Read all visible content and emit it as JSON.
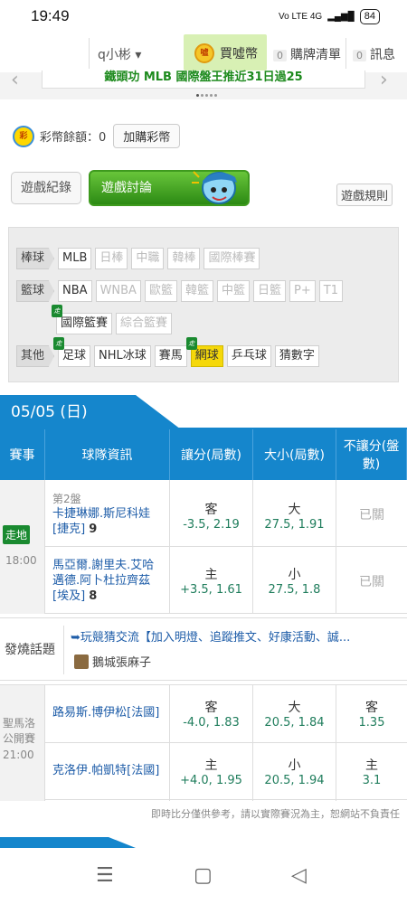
{
  "status_bar": {
    "time": "19:49",
    "network": "Vo LTE 4G",
    "battery": "84"
  },
  "topnav": {
    "user": "q小彬 ▾",
    "buy_coin": "買噓幣",
    "coin_icon_text": "噓",
    "cart": {
      "count": "0",
      "label": "購牌清單"
    },
    "messages": {
      "count": "0",
      "label": "訊息"
    }
  },
  "banner": {
    "text": "鐵頭功 MLB 國際盤王推近31日過25"
  },
  "balance": {
    "icon_text": "彩",
    "label": "彩幣餘額：0",
    "button": "加購彩幣"
  },
  "tabs": {
    "log": "遊戲紀錄",
    "discuss": "遊戲討論",
    "rules": "遊戲規則"
  },
  "categories": {
    "baseball": {
      "head": "棒球",
      "items": [
        "MLB",
        "日棒",
        "中職",
        "韓棒",
        "國際棒賽"
      ]
    },
    "basketball": {
      "head": "籃球",
      "items": [
        "NBA",
        "WNBA",
        "歐籃",
        "韓籃",
        "中籃",
        "日籃",
        "P+",
        "T1"
      ],
      "items2": [
        "國際籃賽",
        "綜合籃賽"
      ]
    },
    "other": {
      "head": "其他",
      "items": [
        "足球",
        "NHL冰球",
        "賽馬",
        "網球",
        "乒乓球",
        "猜數字"
      ]
    },
    "walk_badge": "走"
  },
  "date": "05/05 (日)",
  "table_head": [
    "賽事",
    "球隊資訊",
    "讓分(局數)",
    "大小(局數)",
    "不讓分(盤數)"
  ],
  "match1": {
    "badge": "走地",
    "time": "18:00",
    "set": "第2盤",
    "team1": "卡捷琳娜.斯尼科娃[捷克]",
    "team1_score": "9",
    "team2": "馬亞爾.謝里夫.艾哈邁德.阿卜杜拉齊茲[埃及]",
    "team2_score": "8",
    "spread1": {
      "label": "客",
      "value": "-3.5, 2.19"
    },
    "total1": {
      "label": "大",
      "value": "27.5, 1.91"
    },
    "spread2": {
      "label": "主",
      "value": "+3.5, 1.61"
    },
    "total2": {
      "label": "小",
      "value": "27.5, 1.8"
    },
    "closed": "已關"
  },
  "discussion": {
    "label": "發燒話題",
    "text": "➥玩競猜交流【加入明燈、追蹤推文、好康活動、誠...",
    "user": "鵝城張麻子"
  },
  "match2": {
    "event": "聖馬洛公開賽",
    "time": "21:00",
    "team1": "路易斯.博伊松[法國]",
    "team2": "克洛伊.帕凱特[法國]",
    "spread1": {
      "label": "客",
      "value": "-4.0, 1.83"
    },
    "total1": {
      "label": "大",
      "value": "20.5, 1.84"
    },
    "ml1": {
      "label": "客",
      "value": "1.35"
    },
    "spread2": {
      "label": "主",
      "value": "+4.0, 1.95"
    },
    "total2": {
      "label": "小",
      "value": "20.5, 1.94"
    },
    "ml2": {
      "label": "主",
      "value": "3.1"
    }
  },
  "disclaimer": "即時比分僅供參考，請以實際賽況為主，恕網站不負責任",
  "bottom_nav": {
    "menu": "☰",
    "home": "▢",
    "back": "◁"
  }
}
